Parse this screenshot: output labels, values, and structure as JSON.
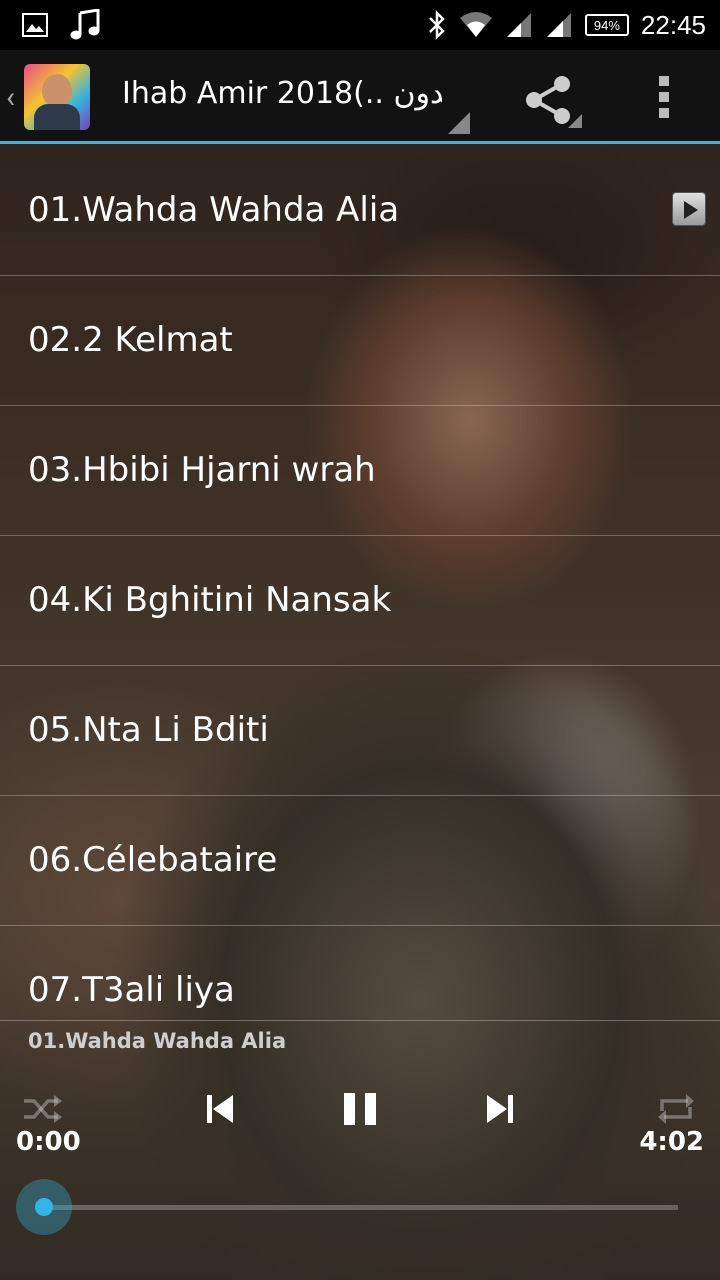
{
  "status_bar": {
    "battery": "94%",
    "time": "22:45"
  },
  "app_bar": {
    "title": "Ihab Amir 2018(.. بدون"
  },
  "tracks": [
    {
      "label": "01.Wahda Wahda Alia",
      "playing": true
    },
    {
      "label": "02.2 Kelmat",
      "playing": false
    },
    {
      "label": "03.Hbibi Hjarni wrah",
      "playing": false
    },
    {
      "label": "04.Ki Bghitini Nansak",
      "playing": false
    },
    {
      "label": "05.Nta Li Bditi",
      "playing": false
    },
    {
      "label": "06.Célebataire",
      "playing": false
    },
    {
      "label": "07.T3ali liya",
      "playing": false
    }
  ],
  "player": {
    "now_playing": "01.Wahda Wahda Alia",
    "elapsed": "0:00",
    "duration": "4:02",
    "progress_fraction": 0.0
  },
  "colors": {
    "accent": "#33b5e5"
  }
}
